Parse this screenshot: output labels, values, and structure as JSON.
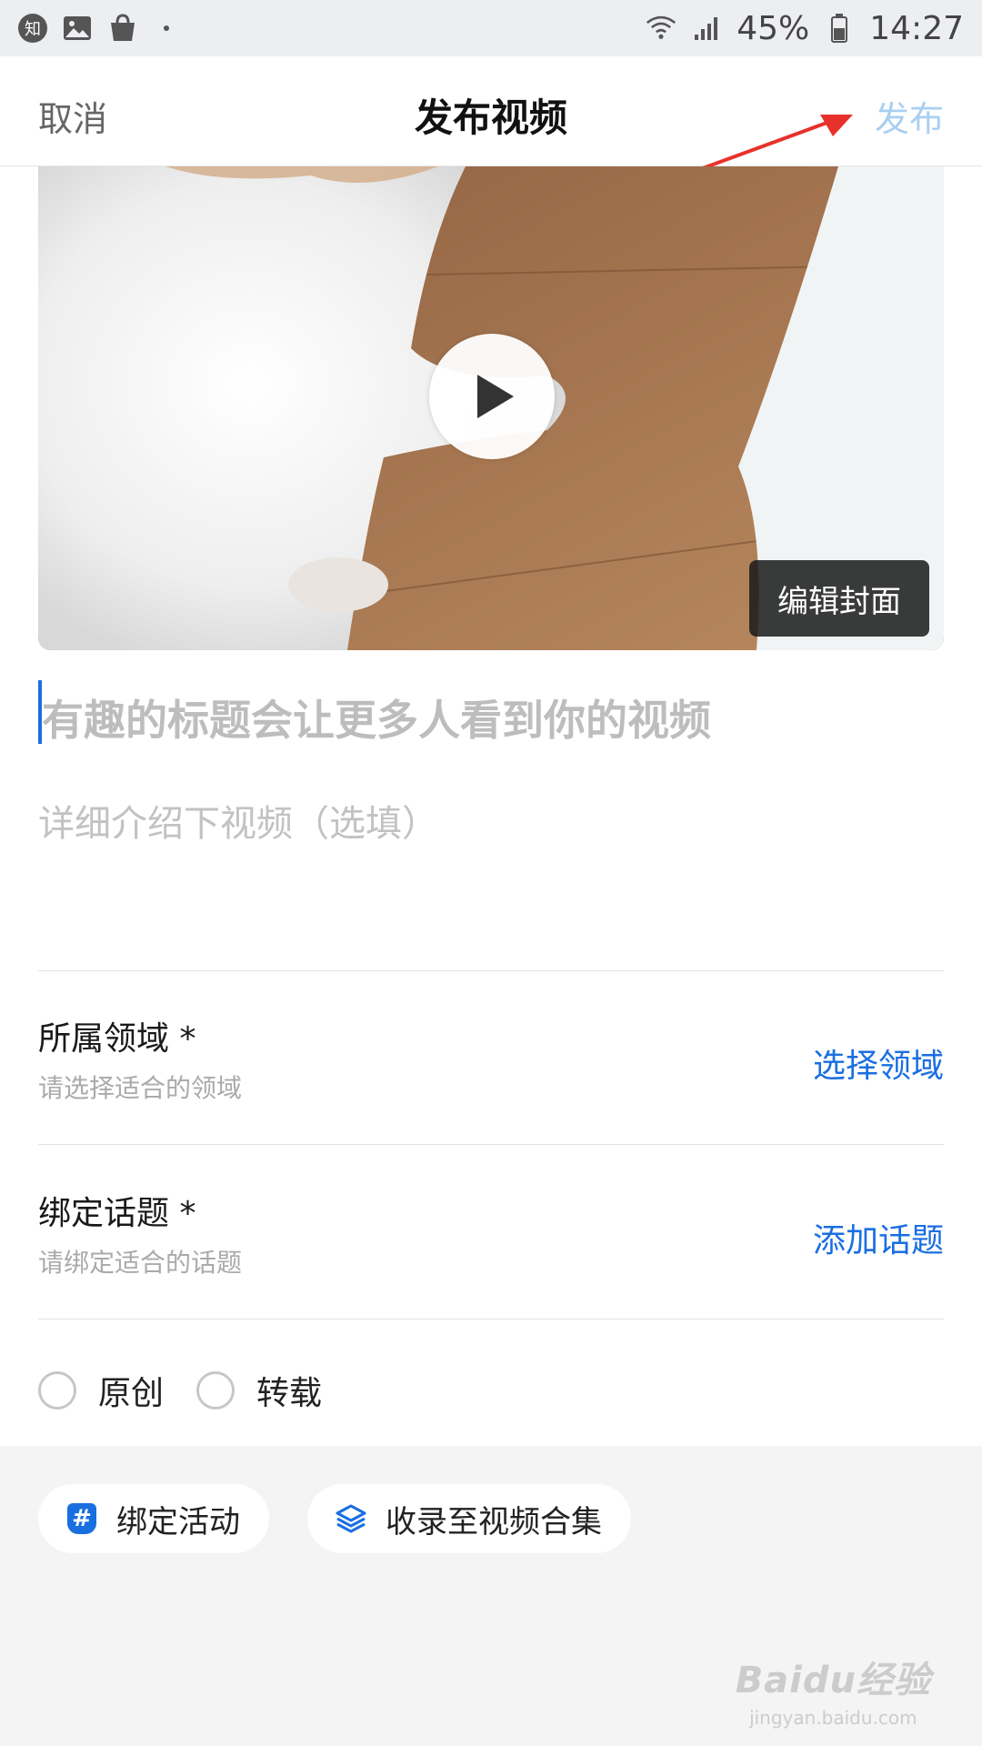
{
  "status_bar": {
    "left_icons": [
      "zhihu-icon",
      "gallery-icon",
      "shopping-bag-icon",
      "dot-icon"
    ],
    "zhihu_glyph": "知",
    "battery_percent": "45%",
    "time": "14:27"
  },
  "header": {
    "cancel": "取消",
    "title": "发布视频",
    "publish": "发布",
    "publish_color": "#a9cff2"
  },
  "video": {
    "edit_cover": "编辑封面"
  },
  "form": {
    "title_placeholder": "有趣的标题会让更多人看到你的视频",
    "description_placeholder": "详细介绍下视频（选填）",
    "domain": {
      "label": "所属领域 *",
      "hint": "请选择适合的领域",
      "action": "选择领域"
    },
    "topic": {
      "label": "绑定话题 *",
      "hint": "请绑定适合的话题",
      "action": "添加话题"
    },
    "source_options": [
      "原创",
      "转载"
    ]
  },
  "extras": {
    "bind_activity": "绑定活动",
    "add_to_collection": "收录至视频合集"
  },
  "watermark": {
    "main": "Baidu经验",
    "sub": "jingyan.baidu.com"
  },
  "colors": {
    "accent": "#1a6fe0",
    "background": "#f4f4f4"
  }
}
